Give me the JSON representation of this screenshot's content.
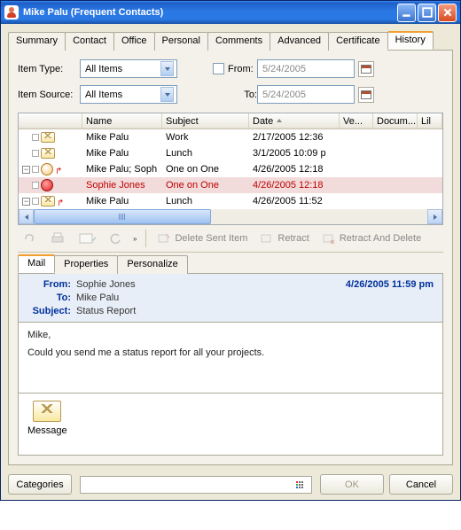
{
  "window": {
    "title": "Mike Palu (Frequent Contacts)"
  },
  "tabs": [
    "Summary",
    "Contact",
    "Office",
    "Personal",
    "Comments",
    "Advanced",
    "Certificate",
    "History"
  ],
  "activeTab": 7,
  "filters": {
    "itemTypeLabel": "Item Type:",
    "itemTypeValue": "All Items",
    "itemSourceLabel": "Item Source:",
    "itemSourceValue": "All Items",
    "fromLabel": "From:",
    "fromDate": "5/24/2005",
    "toLabel": "To:",
    "toDate": "5/24/2005"
  },
  "columns": {
    "name": "Name",
    "subject": "Subject",
    "date": "Date",
    "ver": "Ve...",
    "doc": "Docum...",
    "lib": "Lil"
  },
  "rows": [
    {
      "tree": "",
      "name": "Mike Palu",
      "subject": "Work",
      "date": "2/17/2005 12:36",
      "sel": false,
      "kind": "mail"
    },
    {
      "tree": "",
      "name": "Mike Palu",
      "subject": "Lunch",
      "date": "3/1/2005 10:09 p",
      "sel": false,
      "kind": "mail"
    },
    {
      "tree": "-",
      "name": "Mike Palu;  Soph",
      "subject": "One on One",
      "date": "4/26/2005 12:18",
      "sel": false,
      "kind": "appt-out"
    },
    {
      "tree": "",
      "name": "Sophie Jones",
      "subject": "One on One",
      "date": "4/26/2005 12:18",
      "sel": true,
      "kind": "appt-red"
    },
    {
      "tree": "-",
      "name": "Mike Palu",
      "subject": "Lunch",
      "date": "4/26/2005 11:52",
      "sel": false,
      "kind": "mail-out"
    }
  ],
  "toolbar2": {
    "deleteSent": "Delete Sent Item",
    "retract": "Retract",
    "retractDelete": "Retract And Delete"
  },
  "subtabs": [
    "Mail",
    "Properties",
    "Personalize"
  ],
  "activeSubtab": 0,
  "mail": {
    "fromLabel": "From:",
    "from": "Sophie Jones",
    "toLabel": "To:",
    "to": "Mike Palu",
    "subjectLabel": "Subject:",
    "subject": "Status Report",
    "timestamp": "4/26/2005 11:59 pm",
    "bodyLine1": "Mike,",
    "bodyLine2": "Could you send me a status report for all your projects."
  },
  "attachment": {
    "label": "Message"
  },
  "footer": {
    "categories": "Categories",
    "ok": "OK",
    "cancel": "Cancel"
  }
}
